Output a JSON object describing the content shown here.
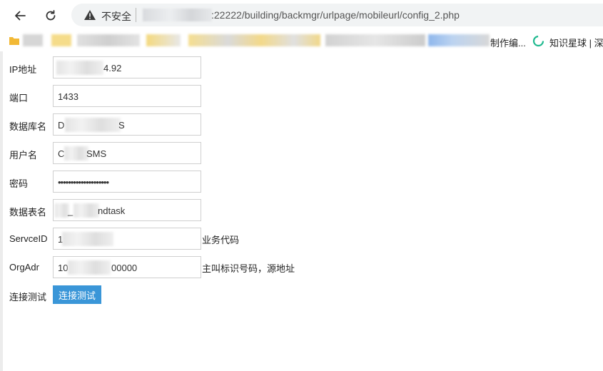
{
  "browser": {
    "security_label": "不安全",
    "url_visible": ":22222/building/backmgr/urlpage/mobileurl/config_2.php",
    "bookmarks": [
      {
        "label": "制作编..."
      },
      {
        "label": "知识星球 | 深度"
      }
    ]
  },
  "form": {
    "ip": {
      "label": "IP地址",
      "value": "4.92"
    },
    "port": {
      "label": "端口",
      "value": "1433"
    },
    "dbname": {
      "label": "数据库名",
      "value_start": "D",
      "value_end": "S"
    },
    "user": {
      "label": "用户名",
      "value_start": "C",
      "value_end": "SMS"
    },
    "password": {
      "label": "密码",
      "value": "••••••••••••••••••••"
    },
    "table": {
      "label": "数据表名",
      "value_start": "_",
      "value_end": "ndtask"
    },
    "serviceid": {
      "label": "ServceID",
      "value_start": "1",
      "hint": "业务代码"
    },
    "orgadr": {
      "label": "OrgAdr",
      "value_start": "10",
      "value_end": "00000",
      "hint": "主叫标识号码，源地址"
    },
    "test": {
      "label": "连接测试",
      "button": "连接测试"
    }
  }
}
